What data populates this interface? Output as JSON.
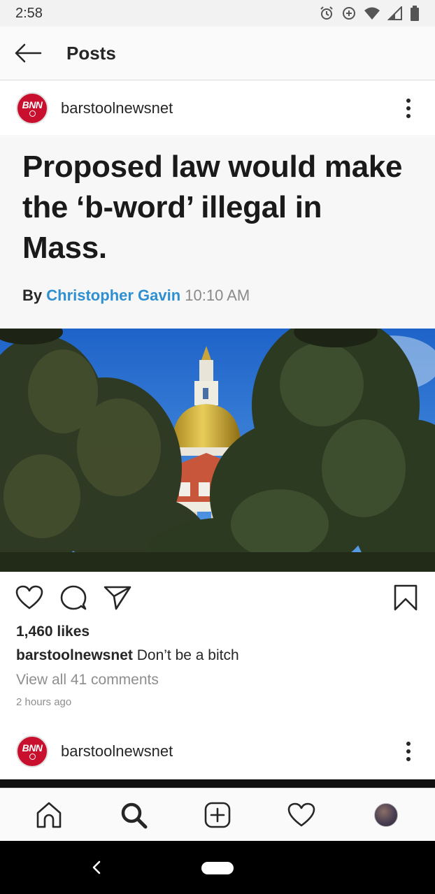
{
  "status_bar": {
    "time": "2:58"
  },
  "header": {
    "title": "Posts"
  },
  "post": {
    "username": "barstoolnewsnet",
    "avatar_text": "BNN",
    "article": {
      "headline": "Proposed law would make the ‘b-word’ illegal in Mass.",
      "by": "By",
      "author": "Christopher Gavin",
      "time": "10:10 AM"
    },
    "likes": "1,460 likes",
    "caption_user": "barstoolnewsnet",
    "caption_text": "Don’t be a bitch",
    "view_comments": "View all 41 comments",
    "timestamp": "2 hours ago"
  },
  "next_post": {
    "username": "barstoolnewsnet",
    "avatar_text": "BNN"
  },
  "icons": {
    "back": "arrow-left-icon",
    "more": "more-vertical-icon",
    "like": "heart-icon",
    "comment": "comment-icon",
    "share": "send-icon",
    "save": "bookmark-icon",
    "home": "home-icon",
    "search": "search-icon",
    "add": "add-post-icon",
    "activity": "heart-icon",
    "profile": "profile-avatar"
  },
  "colors": {
    "author_link": "#2e8fd1",
    "avatar_brand": "#c8102e",
    "muted_text": "#8e8e8e"
  }
}
